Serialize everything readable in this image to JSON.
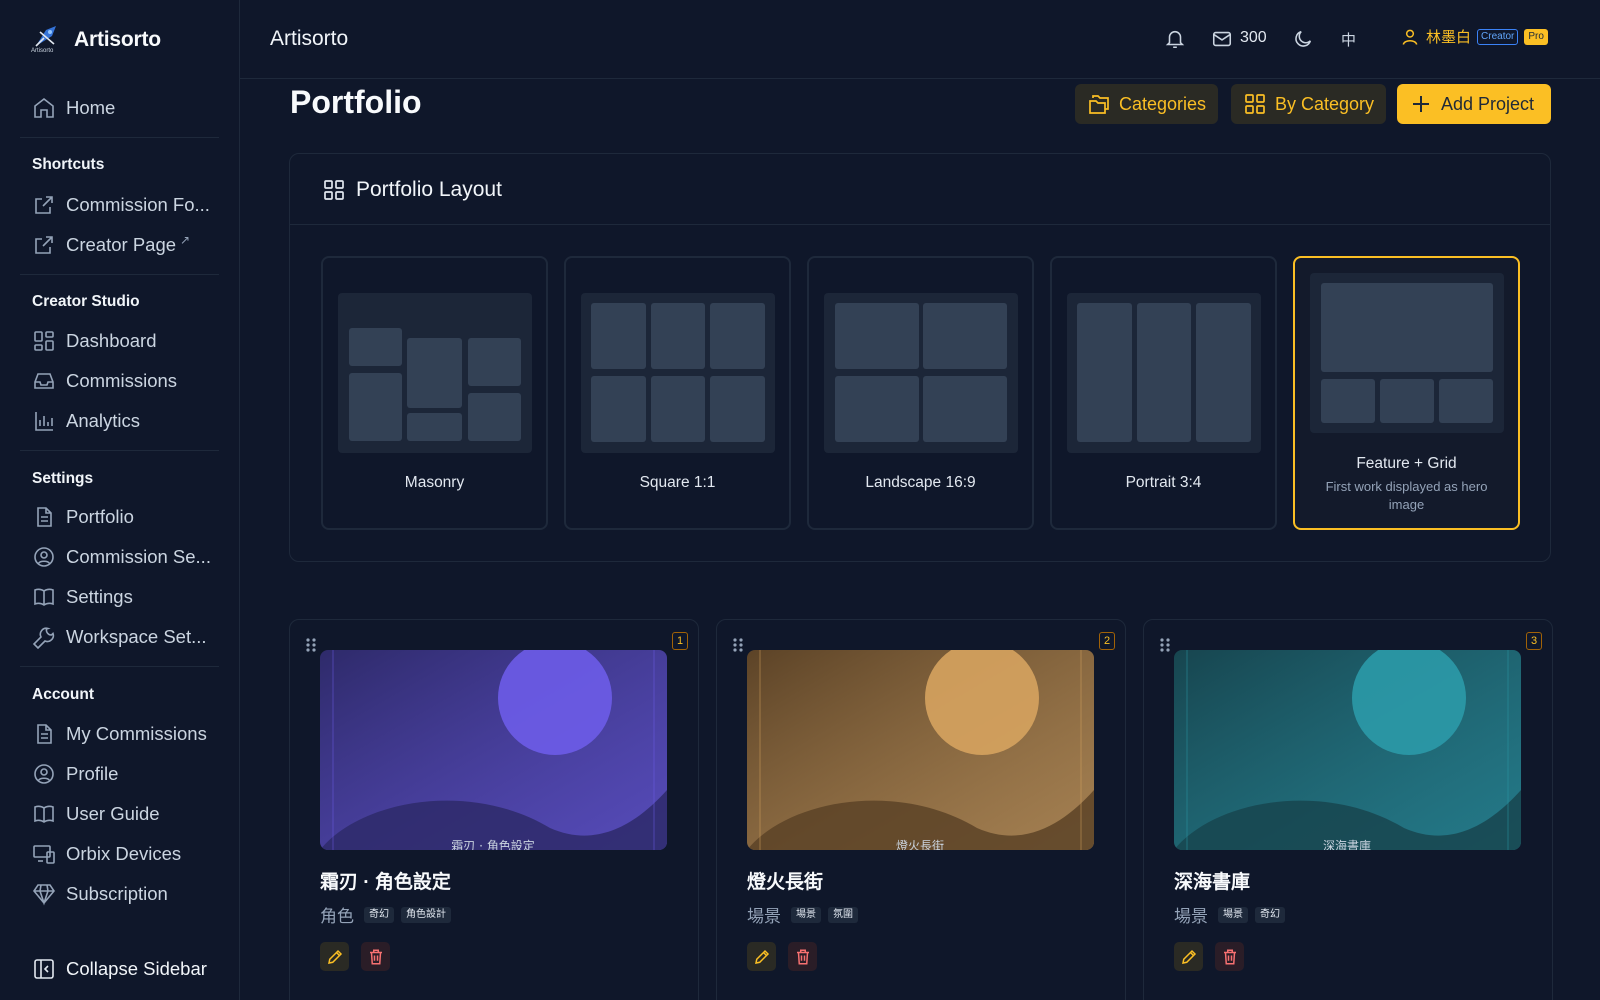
{
  "brand": {
    "name": "Artisorto",
    "logo_caption": "Artisorto",
    "logo_icon": "pen-nib-logo"
  },
  "sidebar": {
    "home": {
      "label": "Home",
      "icon": "home-icon"
    },
    "sections": [
      {
        "heading": "Shortcuts",
        "items": [
          {
            "label": "Commission Fo...",
            "icon": "external-link-icon"
          },
          {
            "label": "Creator Page",
            "icon": "external-link-icon",
            "suffix": "↗"
          }
        ]
      },
      {
        "heading": "Creator Studio",
        "items": [
          {
            "label": "Dashboard",
            "icon": "dashboard-icon"
          },
          {
            "label": "Commissions",
            "icon": "inbox-icon"
          },
          {
            "label": "Analytics",
            "icon": "bar-chart-icon"
          }
        ]
      },
      {
        "heading": "Settings",
        "items": [
          {
            "label": "Portfolio",
            "icon": "document-icon"
          },
          {
            "label": "Commission Se...",
            "icon": "user-circle-icon"
          },
          {
            "label": "Settings",
            "icon": "book-icon"
          },
          {
            "label": "Workspace Set...",
            "icon": "wrench-icon"
          }
        ]
      },
      {
        "heading": "Account",
        "items": [
          {
            "label": "My Commissions",
            "icon": "document-icon"
          },
          {
            "label": "Profile",
            "icon": "user-circle-icon"
          },
          {
            "label": "User Guide",
            "icon": "book-icon"
          },
          {
            "label": "Orbix Devices",
            "icon": "devices-icon"
          },
          {
            "label": "Subscription",
            "icon": "diamond-icon"
          }
        ]
      }
    ],
    "collapse_label": "Collapse Sidebar"
  },
  "topbar": {
    "title": "Artisorto",
    "message_count": "300",
    "language": "中",
    "user_name": "林墨白",
    "badge_role": "Creator",
    "badge_plan": "Pro"
  },
  "page": {
    "title": "Portfolio",
    "buttons": {
      "categories": "Categories",
      "by_category": "By Category",
      "add_project": "Add Project"
    }
  },
  "layout_section": {
    "title": "Portfolio Layout",
    "options": [
      {
        "label": "Masonry",
        "selected": false
      },
      {
        "label": "Square 1:1",
        "selected": false
      },
      {
        "label": "Landscape 16:9",
        "selected": false
      },
      {
        "label": "Portrait 3:4",
        "selected": false
      },
      {
        "label": "Feature + Grid",
        "description": "First work displayed as hero image",
        "selected": true
      }
    ]
  },
  "projects": [
    {
      "index": "1",
      "title": "霜刃 · 角色設定",
      "thumb_text": "霜刃 · 角色設定",
      "category": "角色",
      "tags": [
        "奇幻",
        "角色設計"
      ],
      "color": "#6d5ce8",
      "dark": "#2e2a6a"
    },
    {
      "index": "2",
      "title": "燈火長街",
      "thumb_text": "燈火長街",
      "category": "場景",
      "tags": [
        "場景",
        "氛圍"
      ],
      "color": "#d6a35f",
      "dark": "#5c4327"
    },
    {
      "index": "3",
      "title": "深海書庫",
      "thumb_text": "深海書庫",
      "category": "場景",
      "tags": [
        "場景",
        "奇幻"
      ],
      "color": "#2b9aa8",
      "dark": "#17454f"
    }
  ],
  "colors": {
    "accent": "#fbbf24",
    "background": "#0f172a",
    "border": "#1e293b",
    "danger": "#f87171"
  }
}
